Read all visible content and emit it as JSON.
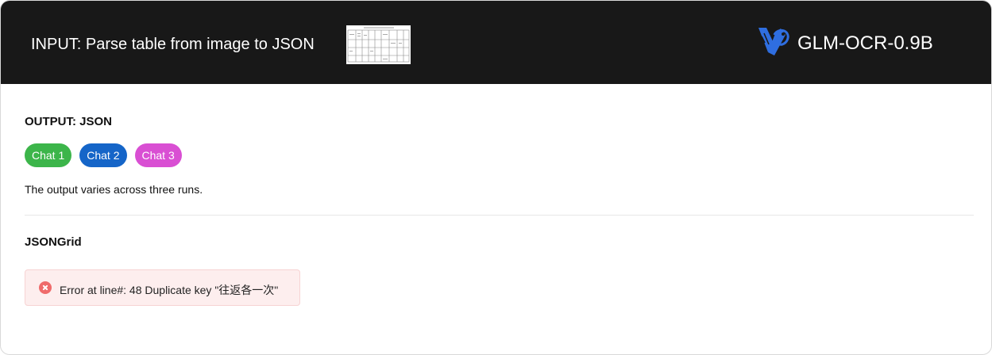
{
  "header": {
    "input_label": "INPUT: Parse table from image to JSON",
    "model_name": "GLM-OCR-0.9B",
    "logo_icon": "glm-logo-icon",
    "thumbnail_icon": "table-image-thumbnail"
  },
  "output": {
    "title": "OUTPUT: JSON",
    "description": "The output varies across three runs."
  },
  "chats": [
    {
      "label": "Chat 1",
      "color": "#3cb54a"
    },
    {
      "label": "Chat 2",
      "color": "#1565c8"
    },
    {
      "label": "Chat 3",
      "color": "#d94fd3"
    }
  ],
  "json_grid": {
    "title": "JSONGrid",
    "error_message": "Error at line#: 48 Duplicate key \"往返各一次\"",
    "error_icon": "error-circle-icon",
    "error_color": "#ef6b6b"
  },
  "colors": {
    "header_bg": "#181818",
    "accent_blue": "#2f6ee0"
  }
}
